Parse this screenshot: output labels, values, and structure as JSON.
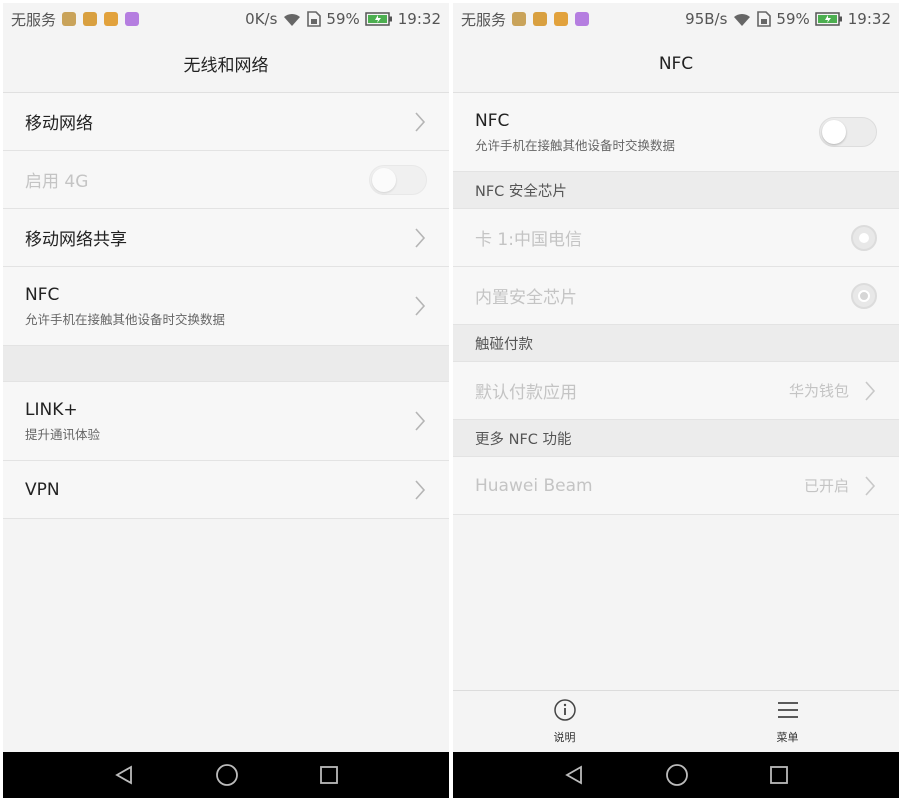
{
  "left": {
    "status": {
      "carrier": "无服务",
      "speed": "0K/s",
      "battery": "59%",
      "time": "19:32"
    },
    "title": "无线和网络",
    "rows": {
      "mobile_network": "移动网络",
      "enable_4g": "启用 4G",
      "tethering": "移动网络共享",
      "nfc_title": "NFC",
      "nfc_desc": "允许手机在接触其他设备时交换数据",
      "link_title": "LINK+",
      "link_desc": "提升通讯体验",
      "vpn": "VPN"
    }
  },
  "right": {
    "status": {
      "carrier": "无服务",
      "speed": "95B/s",
      "battery": "59%",
      "time": "19:32"
    },
    "title": "NFC",
    "nfc_row": {
      "title": "NFC",
      "desc": "允许手机在接触其他设备时交换数据"
    },
    "sections": {
      "secure_chip": "NFC 安全芯片",
      "tap_pay": "触碰付款",
      "more_nfc": "更多 NFC 功能"
    },
    "chip_options": {
      "card1": "卡 1:中国电信",
      "builtin": "内置安全芯片"
    },
    "payment": {
      "label": "默认付款应用",
      "value": "华为钱包"
    },
    "beam": {
      "label": "Huawei Beam",
      "value": "已开启"
    },
    "bottom_bar": {
      "info_label": "说明",
      "menu_label": "菜单"
    }
  },
  "colors": {
    "notif1": "#c9a35a",
    "notif2": "#d9a040",
    "notif3": "#e2a23c",
    "notif4": "#b57ee0",
    "battery_fill": "#4caf50"
  },
  "icons": [
    "wifi-icon",
    "sim-icon",
    "battery-icon",
    "chevron-right-icon",
    "info-icon",
    "menu-icon",
    "back-icon",
    "home-icon",
    "recents-icon"
  ]
}
